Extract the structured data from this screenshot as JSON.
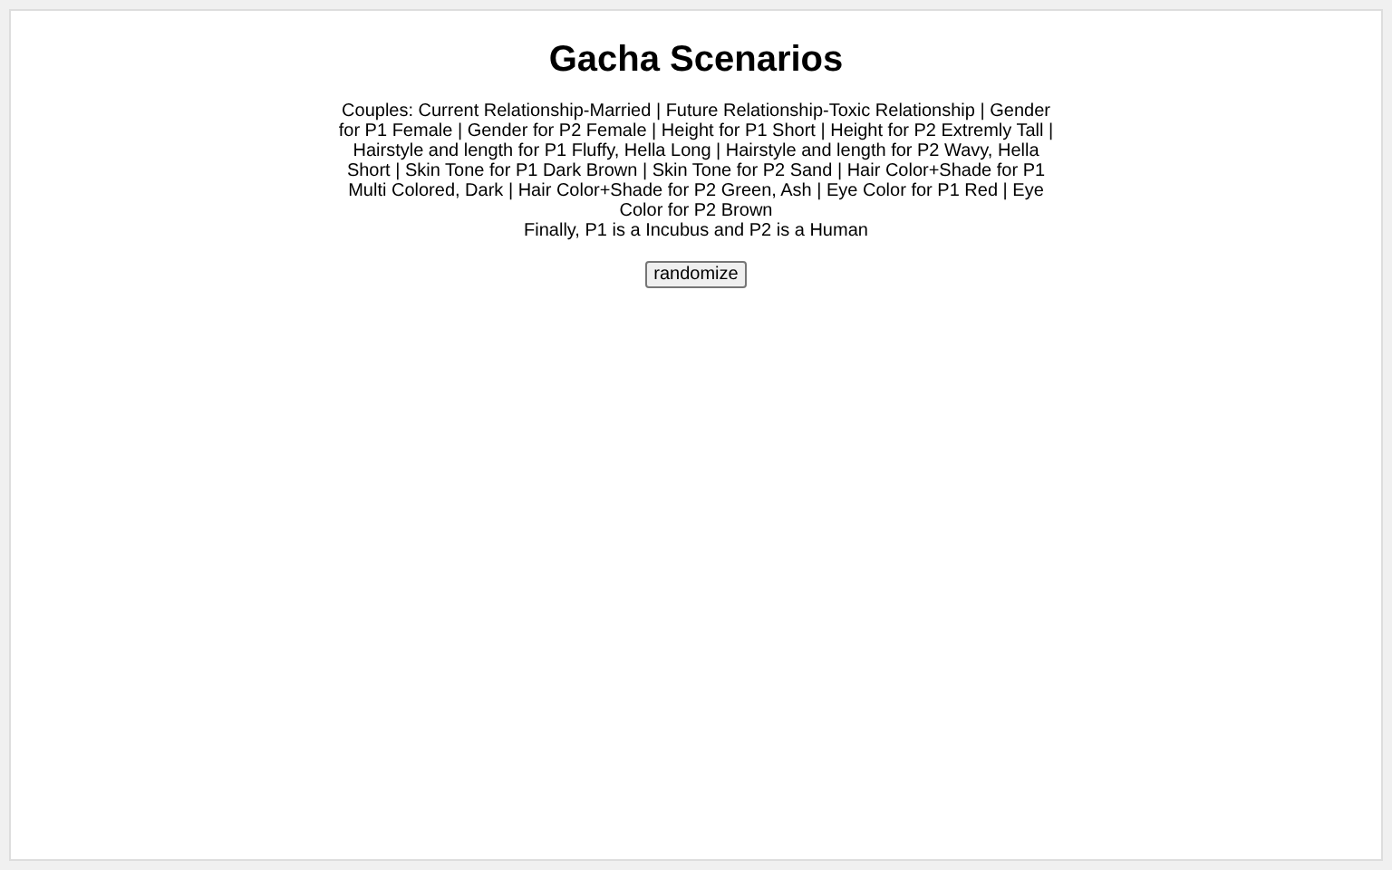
{
  "title": "Gacha Scenarios",
  "scenario": "Couples: Current Relationship-Married | Future Relationship-Toxic Relationship | Gender for P1 Female | Gender for P2 Female | Height for P1 Short | Height for P2 Extremly Tall | Hairstyle and length for P1 Fluffy, Hella Long | Hairstyle and length for P2 Wavy, Hella Short | Skin Tone for P1 Dark Brown | Skin Tone for P2 Sand | Hair Color+Shade for P1 Multi Colored, Dark | Hair Color+Shade for P2 Green, Ash | Eye Color for P1 Red | Eye Color for P2 Brown",
  "finale": "Finally, P1 is a Incubus and P2 is a Human",
  "button": "randomize"
}
